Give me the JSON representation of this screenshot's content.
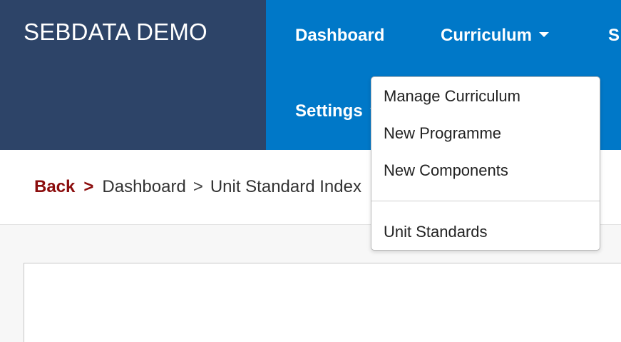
{
  "brand": {
    "title": "SEBDATA DEMO"
  },
  "nav": {
    "dashboard": "Dashboard",
    "curriculum": "Curriculum",
    "settings": "Settings",
    "cutoff": "S"
  },
  "breadcrumb": {
    "back": "Back",
    "sep_strong": ">",
    "dashboard": "Dashboard",
    "sep": ">",
    "current": "Unit Standard Index"
  },
  "dropdown": {
    "items": [
      "Manage Curriculum",
      "New Programme",
      "New Components",
      "Unit Standards"
    ]
  },
  "colors": {
    "brand_bg": "#2d4468",
    "navbar_bg": "#0078c8",
    "back_link": "#8b0d0d"
  }
}
